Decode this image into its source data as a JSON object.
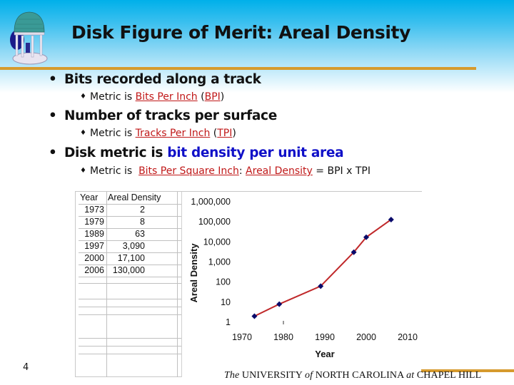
{
  "slide": {
    "title": "Disk Figure of Merit: Areal Density",
    "page_number": "4",
    "logo": "old-well-logo",
    "colors": {
      "header_top": "#00b0ea",
      "accent_rule": "#d69a2d",
      "link_red": "#c01818",
      "emphasis_blue": "#1010c8",
      "series_line": "#c0282a",
      "series_marker": "#0a0a6a"
    }
  },
  "bullets": [
    {
      "text": "Bits recorded along a track",
      "sub": {
        "prefix": "Metric is ",
        "link1": "Bits Per Inch",
        "mid": " (",
        "link2": "BPI",
        "suffix": ")"
      }
    },
    {
      "text": "Number of tracks per surface",
      "sub": {
        "prefix": "Metric is ",
        "link1": "Tracks Per Inch",
        "mid": " (",
        "link2": "TPI",
        "suffix": ")"
      }
    },
    {
      "text_plain": "Disk metric is ",
      "text_emph": "bit density per unit area",
      "sub": {
        "prefix": "Metric is  ",
        "link1": "Bits Per Square Inch",
        "mid": ": ",
        "link2": "Areal Density",
        "eq": " = ",
        "suffix": "BPI x TPI"
      }
    }
  ],
  "table": {
    "headers": [
      "Year",
      "Areal Density"
    ],
    "rows": [
      [
        "1973",
        "2"
      ],
      [
        "1979",
        "8"
      ],
      [
        "1989",
        "63"
      ],
      [
        "1997",
        "3,090"
      ],
      [
        "2000",
        "17,100"
      ],
      [
        "2006",
        "130,000"
      ]
    ]
  },
  "chart_data": {
    "type": "line",
    "title": "",
    "xlabel": "Year",
    "ylabel": "Areal Density",
    "yscale": "log",
    "xlim": [
      1970,
      2010
    ],
    "ylim": [
      1,
      1000000
    ],
    "x_ticks": [
      "1970",
      "1980",
      "1990",
      "2000",
      "2010"
    ],
    "y_ticks": [
      "1",
      "10",
      "100",
      "1,000",
      "10,000",
      "100,000",
      "1,000,000"
    ],
    "grid": false,
    "legend": "none",
    "series": [
      {
        "name": "Areal Density",
        "x": [
          1973,
          1979,
          1989,
          1997,
          2000,
          2006
        ],
        "values": [
          2,
          8,
          63,
          3090,
          17100,
          130000
        ]
      }
    ]
  },
  "footer": {
    "the": "The",
    "university": " UNIVERSITY ",
    "of": "of",
    "nc": " NORTH CAROLINA ",
    "at": "at",
    "chapel": " CHAPEL HILL"
  }
}
